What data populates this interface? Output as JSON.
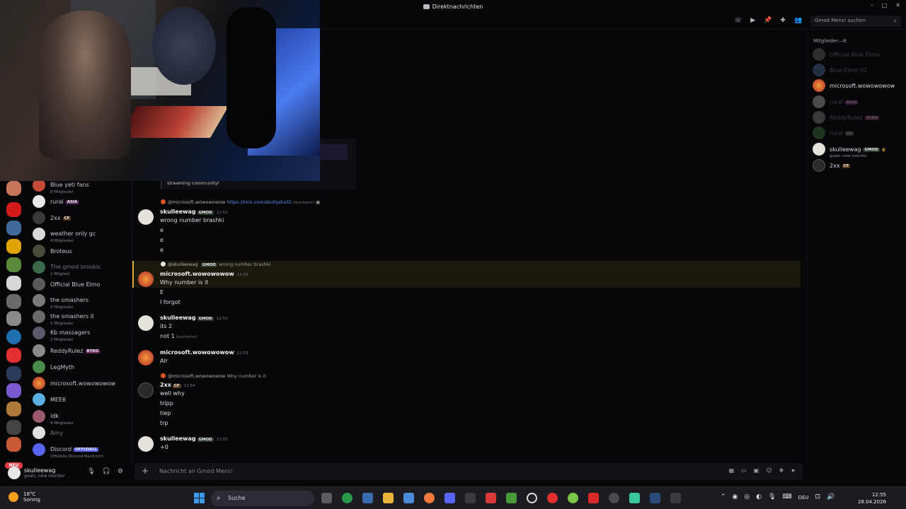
{
  "window": {
    "title": "Direktnachrichten"
  },
  "header": {
    "search_placeholder": "Gmod Mens! suchen"
  },
  "cam_embed_text": "streaming community!",
  "dm_list": [
    {
      "name": "Blue yeti fans",
      "sub": "8 Mitglieder"
    },
    {
      "name": "rural",
      "tag": "ASIA"
    },
    {
      "name": "2xx",
      "tag": "CF"
    },
    {
      "name": "weather only gc",
      "sub": "4 Mitglieder"
    },
    {
      "name": "Broteus"
    },
    {
      "name": "The gmod broskis",
      "sub": "1 Mitglied"
    },
    {
      "name": "Official Blue Elmo"
    },
    {
      "name": "the smashers",
      "sub": "9 Mitglieder"
    },
    {
      "name": "the smashers II",
      "sub": "5 Mitglieder"
    },
    {
      "name": "Kb massagers",
      "sub": "2 Mitglieder"
    },
    {
      "name": "ReddyRulez",
      "tag": "RTRO"
    },
    {
      "name": "LegMyth"
    },
    {
      "name": "microsoft.wowowowow"
    },
    {
      "name": "MEE6"
    },
    {
      "name": "idk",
      "sub": "4 Mitglieder"
    },
    {
      "name": "Amy"
    },
    {
      "name": "Discord",
      "tag": "OFFIZIELL",
      "sub": "Offizielle Discord-Nachricht"
    }
  ],
  "user_panel": {
    "name": "skulleewag",
    "status": "goals: new monitor"
  },
  "messages": {
    "reply1": {
      "user": "@microsoft.wowowowow",
      "link": "https://kick.com/skullyskall2",
      "edited": "(bearbeitet)"
    },
    "m1": {
      "user": "skulleewag",
      "tag": "GMOD",
      "time": "12:53",
      "lines": [
        "wrong number brashki",
        "e",
        "e",
        "e"
      ]
    },
    "reply2": {
      "user": "@skulleewag",
      "tag": "GMOD",
      "text": "wrong number brashki"
    },
    "m2": {
      "user": "microsoft.wowowowow",
      "time": "12:53",
      "lines": [
        "Why number is it",
        "E",
        "I forgot"
      ]
    },
    "m3": {
      "user": "skulleewag",
      "tag": "GMOD",
      "time": "12:53",
      "lines": [
        "its 2",
        "not 1"
      ],
      "edited": "(bearbeitet)"
    },
    "m4": {
      "user": "microsoft.wowowowow",
      "time": "12:53",
      "lines": [
        "Alr"
      ]
    },
    "reply3": {
      "user": "@microsoft.wowowowow",
      "text": "Why number is it"
    },
    "m5": {
      "user": "2xx",
      "tag": "CF",
      "time": "12:54",
      "lines": [
        "well why",
        "tripp",
        "tiep",
        "trp"
      ]
    },
    "m6": {
      "user": "skulleewag",
      "tag": "GMOD",
      "time": "12:55",
      "lines": [
        "+0"
      ]
    }
  },
  "composer": {
    "placeholder": "Nachricht an Gmod Mens!"
  },
  "members": {
    "header": "Mitglieder—8",
    "list": [
      {
        "name": "Official Blue Elmo",
        "faded": true
      },
      {
        "name": "Blue Elmo V2",
        "faded": true
      },
      {
        "name": "microsoft.wowowowow",
        "faded": false
      },
      {
        "name": "rural",
        "tag": "ASIA",
        "faded": true
      },
      {
        "name": "ReddyRulez",
        "tag": "RTRO",
        "faded": true
      },
      {
        "name": "rural",
        "tag": "GE",
        "faded": true
      },
      {
        "name": "skulleewag",
        "tag": "GMOD",
        "status": "goals: new monitor",
        "faded": false
      },
      {
        "name": "2xx",
        "tag": "CF",
        "faded": false
      }
    ]
  },
  "taskbar": {
    "weather_temp": "18°C",
    "weather_desc": "Sonnig",
    "search_label": "Suche",
    "language": "DEU",
    "time": "12:55",
    "date": "28.04.2026"
  },
  "rail_badge": "NEU"
}
